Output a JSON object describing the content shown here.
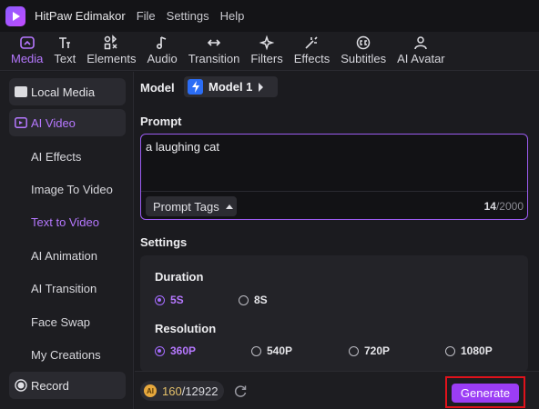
{
  "titlebar": {
    "app_name": "HitPaw Edimakor",
    "menus": [
      "File",
      "Settings",
      "Help"
    ]
  },
  "toolbar": {
    "tools": [
      {
        "label": "Media",
        "icon": "media-icon",
        "active": true
      },
      {
        "label": "Text",
        "icon": "text-icon"
      },
      {
        "label": "Elements",
        "icon": "elements-icon"
      },
      {
        "label": "Audio",
        "icon": "audio-icon"
      },
      {
        "label": "Transition",
        "icon": "transition-icon"
      },
      {
        "label": "Filters",
        "icon": "filters-icon"
      },
      {
        "label": "Effects",
        "icon": "effects-icon"
      },
      {
        "label": "Subtitles",
        "icon": "subtitles-icon"
      },
      {
        "label": "AI Avatar",
        "icon": "ai-avatar-icon"
      }
    ]
  },
  "sidebar": {
    "local_media": "Local Media",
    "ai_video": "AI Video",
    "sub_items": [
      "AI Effects",
      "Image To Video",
      "Text to Video",
      "AI Animation",
      "AI Transition",
      "Face Swap",
      "My Creations"
    ],
    "active_sub": "Text to Video",
    "record": "Record"
  },
  "model": {
    "label": "Model",
    "value": "Model 1"
  },
  "prompt": {
    "label": "Prompt",
    "text": "a laughing cat",
    "tags_button": "Prompt Tags",
    "count": "14",
    "limit": "/2000"
  },
  "settings": {
    "label": "Settings",
    "duration_title": "Duration",
    "durations": [
      "5S",
      "8S"
    ],
    "duration_selected": "5S",
    "resolution_title": "Resolution",
    "resolutions": [
      "360P",
      "540P",
      "720P",
      "1080P"
    ],
    "resolution_selected": "360P"
  },
  "bottom": {
    "credits_used": "160",
    "credits_total": "/12922",
    "generate": "Generate"
  },
  "colors": {
    "accent": "#b678ff",
    "generate_bg": "#9b3df5",
    "highlight_border": "#e0121b"
  }
}
